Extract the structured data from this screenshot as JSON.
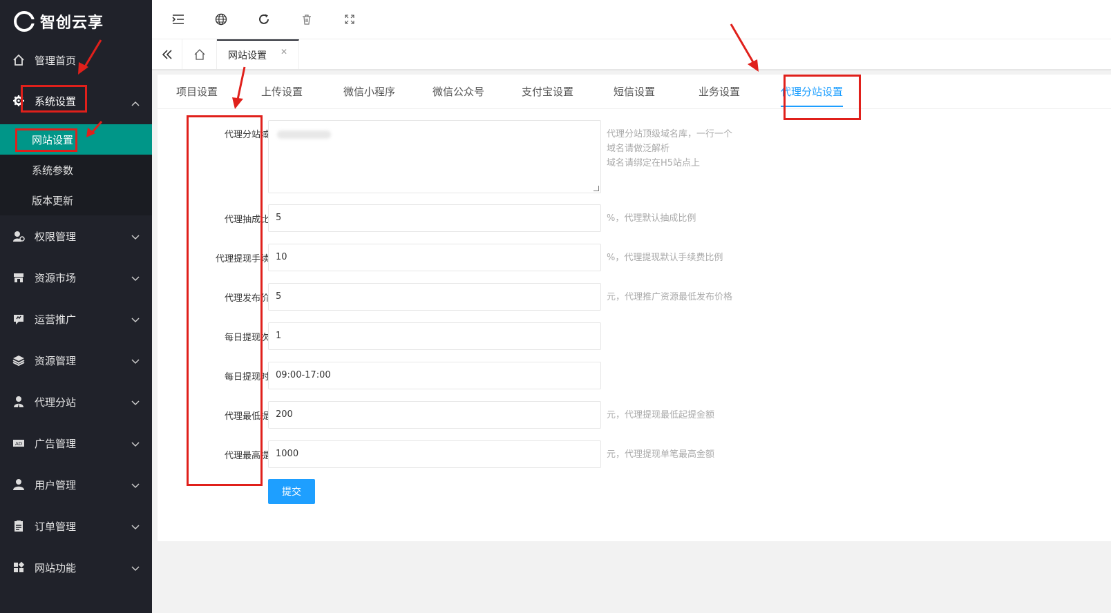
{
  "brand": {
    "name": "智创云享"
  },
  "sidebar": {
    "items": [
      {
        "label": "管理首页",
        "icon": "home-icon"
      },
      {
        "label": "系统设置",
        "icon": "gear-icon",
        "expanded": true,
        "sub": [
          {
            "label": "网站设置",
            "active": true
          },
          {
            "label": "系统参数"
          },
          {
            "label": "版本更新"
          }
        ]
      },
      {
        "label": "权限管理",
        "icon": "permission-icon"
      },
      {
        "label": "资源市场",
        "icon": "store-icon"
      },
      {
        "label": "运营推广",
        "icon": "promo-icon"
      },
      {
        "label": "资源管理",
        "icon": "layers-icon"
      },
      {
        "label": "代理分站",
        "icon": "agent-icon"
      },
      {
        "label": "广告管理",
        "icon": "ad-icon"
      },
      {
        "label": "用户管理",
        "icon": "user-icon"
      },
      {
        "label": "订单管理",
        "icon": "order-icon"
      },
      {
        "label": "网站功能",
        "icon": "grid-icon"
      }
    ]
  },
  "topbar": {
    "icons": [
      "menu-fold-icon",
      "globe-icon",
      "refresh-icon",
      "trash-icon",
      "fullscreen-icon"
    ]
  },
  "tabbar": {
    "current_tab": "网站设置",
    "close": "✕"
  },
  "subtabs": [
    {
      "label": "项目设置"
    },
    {
      "label": "上传设置"
    },
    {
      "label": "微信小程序"
    },
    {
      "label": "微信公众号"
    },
    {
      "label": "支付宝设置"
    },
    {
      "label": "短信设置"
    },
    {
      "label": "业务设置"
    },
    {
      "label": "代理分站设置",
      "active": true
    }
  ],
  "form": {
    "domain": {
      "label": "代理分站域名",
      "hints": [
        "代理分站顶级域名库，一行一个",
        "域名请做泛解析",
        "域名请绑定在H5站点上"
      ]
    },
    "fields": [
      {
        "label": "代理抽成比例",
        "value": "5",
        "hint": "%，代理默认抽成比例"
      },
      {
        "label": "代理提现手续费",
        "value": "10",
        "hint": "%，代理提现默认手续费比例"
      },
      {
        "label": "代理发布价格",
        "value": "5",
        "hint": "元，代理推广资源最低发布价格"
      },
      {
        "label": "每日提现次数",
        "value": "1",
        "hint": ""
      },
      {
        "label": "每日提现时间",
        "value": "09:00-17:00",
        "hint": ""
      },
      {
        "label": "代理最低提现",
        "value": "200",
        "hint": "元，代理提现最低起提金额"
      },
      {
        "label": "代理最高提现",
        "value": "1000",
        "hint": "元，代理提现单笔最高金额"
      }
    ],
    "submit_label": "提交"
  },
  "colors": {
    "sidebar_bg": "#20222a",
    "active_sub_bg": "#009688",
    "accent_blue": "#1e9fff",
    "annotation_red": "#e0201b"
  }
}
